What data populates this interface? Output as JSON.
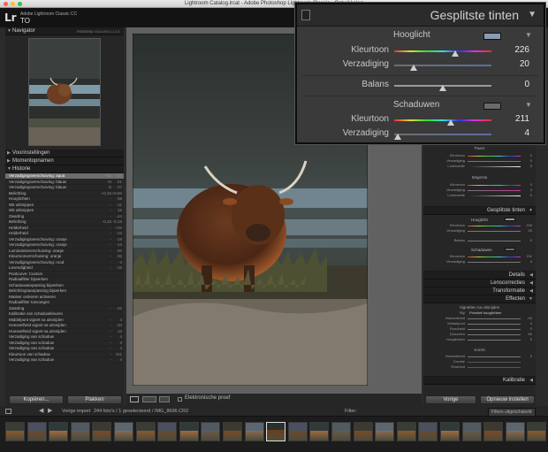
{
  "window": {
    "title": "Lightroom Catalog.lrcat - Adobe Photoshop Lightroom Classic - Ontwikkelen"
  },
  "identity": {
    "logo": "Lr",
    "app_name": "Adobe Lightroom Classic CC",
    "user": "TO"
  },
  "navigator": {
    "title": "Navigator",
    "tabs": "PASSEND  VULLEN  1:1  2:1"
  },
  "left_panels": {
    "presets": "Voorinstellingen",
    "snapshots": "Momentopnamen",
    "history": "Historie"
  },
  "history": [
    [
      "Verzadigingsverschuiving: aqua",
      "+60",
      "-37",
      true
    ],
    [
      "Verzadigingsverschuiving: blauw",
      "+6",
      "-21",
      false
    ],
    [
      "Verzadigingsverschuiving: blauw",
      "-5",
      "-27",
      false
    ],
    [
      "Belichting",
      "+0,15",
      "+0,50",
      false
    ],
    [
      "Hooglichten",
      "-",
      "-38",
      false
    ],
    [
      "Wit uitknippen",
      "-",
      "-11",
      false
    ],
    [
      "Wit uitknippen",
      "-",
      "15",
      false
    ],
    [
      "Zwarting",
      "-",
      "-44",
      false
    ],
    [
      "Belichting",
      "-0,15",
      "-0,15",
      false
    ],
    [
      "Helderheid",
      "-",
      "+22",
      false
    ],
    [
      "Helderheid",
      "-",
      "-13",
      false
    ],
    [
      "Verzadigingsverschuiving: oranje",
      "-",
      "-19",
      false
    ],
    [
      "Verzadigingsverschuiving: oranje",
      "-",
      "-13",
      false
    ],
    [
      "Luminantieverschuiving: oranje",
      "-",
      "-20",
      false
    ],
    [
      "Kleurtoonverschuiving: oranje",
      "-",
      "-35",
      false
    ],
    [
      "Verzadigingsverschuiving: rood",
      "-",
      "-4",
      false
    ],
    [
      "Levendigheid",
      "-",
      "-12",
      false
    ],
    [
      "Puntcurve: Custom",
      "",
      "",
      " "
    ],
    [
      "Radiaalfilter bijwerken",
      "",
      "",
      false
    ],
    [
      "Schaduwaanpassing bijwerken",
      "",
      "",
      false
    ],
    [
      "Belichtingsaanpassing bijwerken",
      "",
      "",
      false
    ],
    [
      "Masker omkeren activeren",
      "",
      "",
      false
    ],
    [
      "Radiaalfilter toevoegen",
      "",
      "",
      false
    ],
    [
      "Zwarting",
      "-",
      "-42",
      false
    ],
    [
      "Kalibratie van schaduwkleuren",
      "",
      "",
      false
    ],
    [
      "Middelpunt vignet na uitsnijden",
      "-",
      "4",
      false
    ],
    [
      "Hoeveelheid vignet na uitsnijden",
      "-",
      "-34",
      false
    ],
    [
      "Hoeveelheid vignet na uitsnijden",
      "-",
      "13",
      false
    ],
    [
      "Verzadiging van schaduw",
      "-",
      "4",
      false
    ],
    [
      "Verzadiging van schaduw",
      "-",
      "3",
      false
    ],
    [
      "Verzadiging van schaduw",
      "-",
      "4",
      false
    ],
    [
      "Kleurtoon van schaduw",
      "-",
      "211",
      false
    ],
    [
      "Verzadiging van schaduw",
      "-",
      "4",
      false
    ]
  ],
  "left_buttons": {
    "copy": "Kopiëren...",
    "paste": "Plakken"
  },
  "center_toolbar": {
    "softproof": "Elektronische proef"
  },
  "right_mini": {
    "paars": "Paars",
    "magenta": "Magenta",
    "kleurtoon": "Kleurtoon",
    "verzadiging": "Verzadiging",
    "luminantie": "Luminantie"
  },
  "right_panels": {
    "split": "Gesplitste tinten",
    "details": "Details",
    "lens": "Lenscorrecties",
    "transform": "Transformatie",
    "effects": "Effecten",
    "calibration": "Kalibratie"
  },
  "right_split": {
    "hooglicht": "Hooglicht",
    "schaduwen": "Schaduwen",
    "kleurtoon_h": "226",
    "verz_h": "20",
    "balans": "0",
    "kleurtoon_s": "211",
    "verz_s": "4",
    "balans_label": "Balans"
  },
  "effects": {
    "vignet_title": "Vignetten na uitsnijden",
    "stijl": "Stijl",
    "stijl_val": "Prioriteit hooglichten",
    "hoeveelheid": "Hoeveelheid",
    "middelpunt": "Middelpunt",
    "rondheid": "Rondheid",
    "doezelen": "Doezelen",
    "hooglichten": "Hooglichten",
    "v_hoev": "-34",
    "v_mid": "4",
    "v_rond": "0",
    "v_doez": "50",
    "v_hoog": "0",
    "korrel": "Korrel",
    "k_hoev": "0",
    "grootte": "Grootte",
    "ruwheid": "Ruwheid"
  },
  "right_buttons": {
    "previous": "Vorige",
    "reset": "Opnieuw instellen"
  },
  "filmstrip": {
    "source": "Vorige import",
    "info": "244 foto's / 1 geselecteerd / IMG_8696.CR2",
    "filter": "Filter:",
    "filter_val": "Filters uitgeschakeld"
  },
  "popup": {
    "title": "Gesplitste tinten",
    "hooglicht": "Hooglicht",
    "kleurtoon_label": "Kleurtoon",
    "verzadiging_label": "Verzadiging",
    "balans_label": "Balans",
    "schaduwen": "Schaduwen",
    "hl_hue": "226",
    "hl_sat": "20",
    "balance": "0",
    "sh_hue": "211",
    "sh_sat": "4",
    "hl_hue_frac": 0.628,
    "hl_sat_frac": 0.2,
    "balance_frac": 0.5,
    "sh_hue_frac": 0.586,
    "sh_sat_frac": 0.04
  },
  "colors": {
    "accent": "#8a9bb5",
    "popup_bg": "#3a3a3a"
  },
  "icons": [
    "close-dot",
    "minimize-dot",
    "zoom-dot",
    "triangle-toggle-icon",
    "loupe-view-icon",
    "compare-icon",
    "filmstrip-grid-icon",
    "back-arrow-icon",
    "forward-arrow-icon"
  ]
}
